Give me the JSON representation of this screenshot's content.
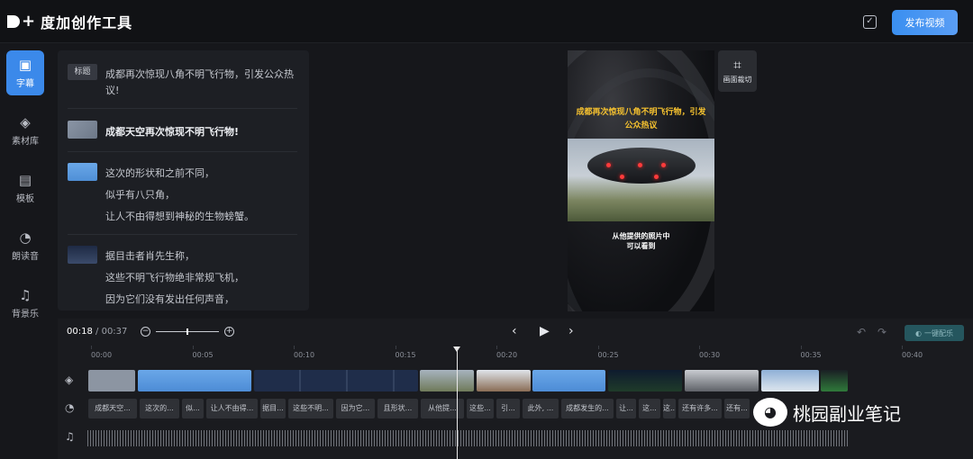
{
  "app": {
    "title": "度加创作工具",
    "publish_label": "发布视频"
  },
  "sidebar": {
    "items": [
      {
        "label": "字幕",
        "icon": "text-box-icon",
        "active": true
      },
      {
        "label": "素材库",
        "icon": "layers-icon"
      },
      {
        "label": "模板",
        "icon": "template-icon"
      },
      {
        "label": "朗读音",
        "icon": "voice-icon"
      },
      {
        "label": "背景乐",
        "icon": "music-note-icon"
      }
    ]
  },
  "script": {
    "title_tag": "标题",
    "title_lines": [
      "成都再次惊现八角不明飞行物，引发公众热",
      "议!"
    ],
    "segments": [
      {
        "lines": [
          "成都天空再次惊现不明飞行物!"
        ]
      },
      {
        "lines": [
          "这次的形状和之前不同，",
          "似乎有八只角，",
          "让人不由得想到神秘的生物螃蟹。"
        ]
      },
      {
        "lines": [
          "据目击者肖先生称，",
          "这些不明飞行物绝非常规飞机，",
          "因为它们没有发出任何声音，"
        ]
      }
    ]
  },
  "preview": {
    "title": "成都再次惊现八角不明飞行物，引发公众热议",
    "subtitle_lines": [
      "从他提供的照片中",
      "可以看到"
    ],
    "crop_label": "画面裁切"
  },
  "timeline": {
    "current_time": "00:18",
    "total_time": "00:37",
    "music_button": "一键配乐",
    "ticks": [
      "00:00",
      "00:05",
      "00:10",
      "00:15",
      "00:20",
      "00:25",
      "00:30",
      "00:35",
      "00:40"
    ],
    "caption_clips": [
      "成都天空...",
      "这次的...",
      "似...",
      "让人不由得...",
      "据目...",
      "这些不明...",
      "因为它...",
      "且形状...",
      "从他提...",
      "这些...",
      "引...",
      "此外, ...",
      "成都发生的...",
      "让...",
      "这...",
      "这...",
      "还有许多...",
      "还有..."
    ]
  },
  "watermark": {
    "text": "桃园副业笔记"
  }
}
